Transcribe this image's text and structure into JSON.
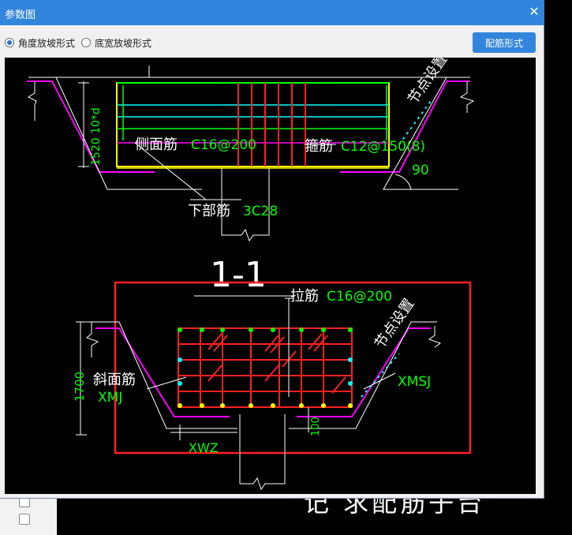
{
  "window": {
    "title": "参数图",
    "close_glyph": "✕"
  },
  "options": [
    {
      "label": "角度放坡形式",
      "selected": true
    },
    {
      "label": "底宽放坡形式",
      "selected": false
    }
  ],
  "config_button": "配筋形式",
  "drawing": {
    "top": {
      "side_rebar_label": "侧面筋",
      "side_rebar_value": "C16@200",
      "stirrup_label": "箍筋",
      "stirrup_value": "C12@150(8)",
      "bottom_rebar_label": "下部筋",
      "bottom_rebar_value": "3C28",
      "angle": "90",
      "dim_vertical": "1520 10*d",
      "node_setting": "节点设置"
    },
    "section_title": "1-1",
    "bottom": {
      "tie_label": "拉筋",
      "tie_value": "C16@200",
      "slope_label": "斜面筋",
      "slope_value": "XMJ",
      "right_value": "XMSJ",
      "bottom_value": "XWZ",
      "dim_height": "1700",
      "dim_small": "100",
      "node_setting": "节点设置"
    }
  },
  "background_text": "记 求配筋子台"
}
